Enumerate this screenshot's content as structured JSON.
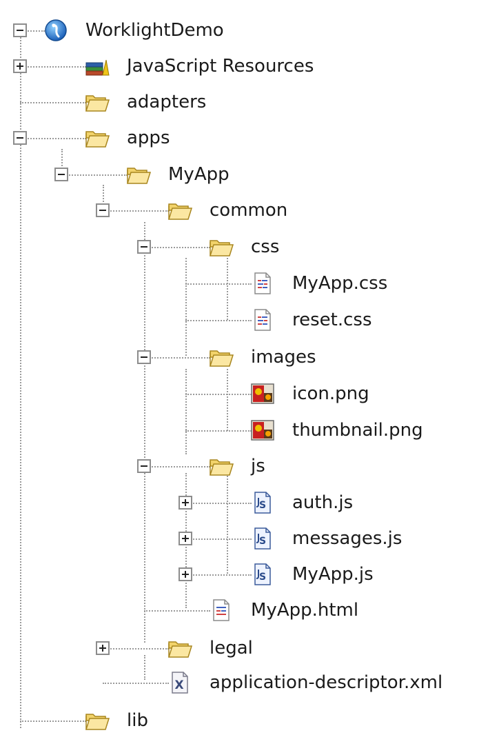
{
  "tree": {
    "rows": [
      {
        "label": "WorklightDemo",
        "icon": "worklight-project-icon",
        "toggle": "collapse"
      },
      {
        "label": "JavaScript Resources",
        "icon": "javascript-resources-icon",
        "toggle": "expand"
      },
      {
        "label": "adapters",
        "icon": "folder-icon",
        "toggle": "none"
      },
      {
        "label": "apps",
        "icon": "folder-icon",
        "toggle": "collapse"
      },
      {
        "label": "MyApp",
        "icon": "folder-icon",
        "toggle": "collapse"
      },
      {
        "label": "common",
        "icon": "folder-icon",
        "toggle": "collapse"
      },
      {
        "label": "css",
        "icon": "folder-icon",
        "toggle": "collapse"
      },
      {
        "label": "MyApp.css",
        "icon": "css-file-icon",
        "toggle": "none"
      },
      {
        "label": "reset.css",
        "icon": "css-file-icon",
        "toggle": "none"
      },
      {
        "label": "images",
        "icon": "folder-icon",
        "toggle": "collapse"
      },
      {
        "label": "icon.png",
        "icon": "image-file-icon",
        "toggle": "none"
      },
      {
        "label": "thumbnail.png",
        "icon": "image-file-icon",
        "toggle": "none"
      },
      {
        "label": "js",
        "icon": "folder-icon",
        "toggle": "collapse"
      },
      {
        "label": "auth.js",
        "icon": "js-file-icon",
        "toggle": "expand"
      },
      {
        "label": "messages.js",
        "icon": "js-file-icon",
        "toggle": "expand"
      },
      {
        "label": "MyApp.js",
        "icon": "js-file-icon",
        "toggle": "expand"
      },
      {
        "label": "MyApp.html",
        "icon": "html-file-icon",
        "toggle": "none"
      },
      {
        "label": "legal",
        "icon": "folder-icon",
        "toggle": "expand"
      },
      {
        "label": "application-descriptor.xml",
        "icon": "xml-file-icon",
        "toggle": "none"
      },
      {
        "label": "lib",
        "icon": "folder-icon",
        "toggle": "none"
      }
    ]
  }
}
